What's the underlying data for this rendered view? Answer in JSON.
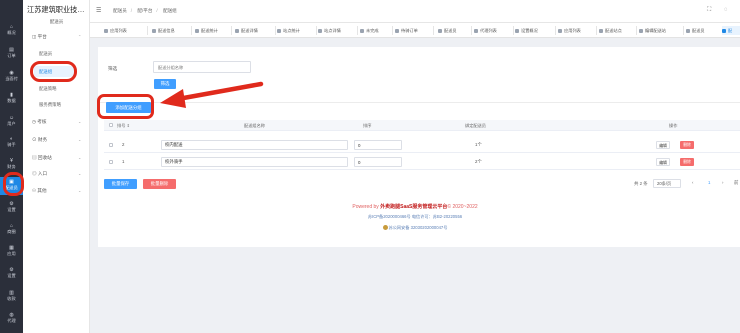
{
  "rail": [
    {
      "icon": "home-icon",
      "glyph": "⌂",
      "label": "概况"
    },
    {
      "icon": "order-icon",
      "glyph": "▤",
      "label": "订单"
    },
    {
      "icon": "pay-icon",
      "glyph": "◉",
      "label": "当面付"
    },
    {
      "icon": "data-icon",
      "glyph": "▮",
      "label": "数据"
    },
    {
      "icon": "user-icon",
      "glyph": "☺",
      "label": "用户"
    },
    {
      "icon": "rider-icon",
      "glyph": "◐",
      "label": "骑手"
    },
    {
      "icon": "finance-icon",
      "glyph": "¥",
      "label": "财务"
    },
    {
      "icon": "delivery-icon",
      "glyph": "▣",
      "label": "配送员"
    },
    {
      "icon": "settings-icon",
      "glyph": "⚙",
      "label": "设置"
    },
    {
      "icon": "shop-icon",
      "glyph": "⌂",
      "label": "商圈"
    },
    {
      "icon": "app-icon",
      "glyph": "▦",
      "label": "应用"
    },
    {
      "icon": "setup-icon",
      "glyph": "⚙",
      "label": "设置"
    },
    {
      "icon": "collect-icon",
      "glyph": "▥",
      "label": "收款"
    },
    {
      "icon": "agent-icon",
      "glyph": "◍",
      "label": "代理"
    }
  ],
  "sidebar": {
    "title": "江苏建筑职业技术学院",
    "subtitle": "配送员",
    "groups": [
      {
        "label": "平台",
        "icon": "platform-icon"
      },
      {
        "label": "考核",
        "icon": "assess-icon"
      },
      {
        "label": "财务",
        "icon": "finance-icon"
      },
      {
        "label": "回收站",
        "icon": "recycle-icon"
      },
      {
        "label": "入口",
        "icon": "entry-icon"
      },
      {
        "label": "其他",
        "icon": "other-icon"
      }
    ],
    "items": [
      "配送员",
      "配送组",
      "配送策略",
      "服务费策略"
    ]
  },
  "header": {
    "crumbs": [
      "配送员",
      "配/平台",
      "配送组"
    ]
  },
  "tabs": [
    "应用列表",
    "配送信息",
    "配送统计",
    "配送详情",
    "站点统计",
    "站点详情",
    "未完成",
    "待骑订单",
    "配送员",
    "代理列表",
    "设置概况",
    "应用列表",
    "配送站点",
    "编辑配送站",
    "配送员",
    "配"
  ],
  "filter": {
    "label": "筛选",
    "placeholder": "配送分组名称",
    "button": "筛选"
  },
  "add_button": "添加配送分组",
  "table": {
    "headers": {
      "sort": "排号",
      "name": "配送组名称",
      "order": "排序",
      "members": "绑定配送员",
      "actions": "操作"
    },
    "rows": [
      {
        "sort": "2",
        "name": "校内配送",
        "order": "0",
        "members": "1个"
      },
      {
        "sort": "1",
        "name": "校外骑手",
        "order": "0",
        "members": "2个"
      }
    ],
    "edit": "编辑",
    "delete": "删除"
  },
  "batch": {
    "save": "批量保存",
    "delete": "批量删除"
  },
  "pagination": {
    "total": "共 2 条",
    "size": "20条/页",
    "prev": "‹",
    "page": "1",
    "next": "›",
    "goto": "前"
  },
  "footer": {
    "prefix": "Powered by ",
    "brand": "外卖跑腿SaaS服务管理云平台",
    "suffix": "© 2020~2022",
    "icp": "苏ICP备2020000466号     电信许可：苏B2-20220556",
    "police": "苏公网安备 32030202000047号"
  },
  "colors": {
    "accent": "#409eff",
    "danger": "#f56c6c",
    "highlight": "#e02a1c"
  }
}
